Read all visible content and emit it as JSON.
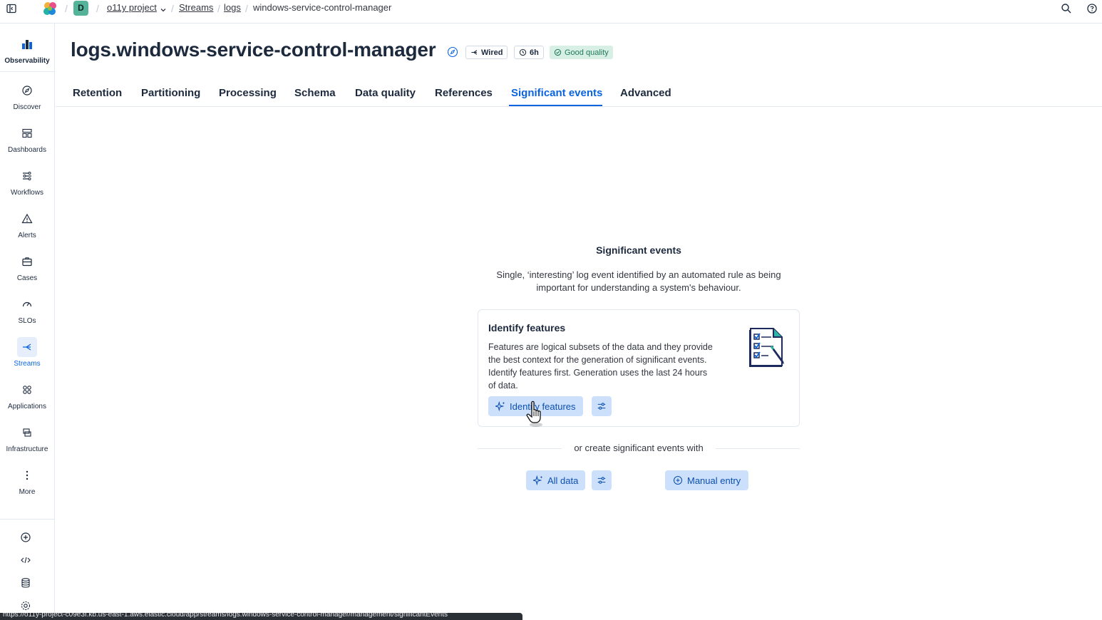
{
  "breadcrumbs": {
    "project_initial": "D",
    "project": "o11y project",
    "streams": "Streams",
    "logs": "logs",
    "current": "windows-service-control-manager"
  },
  "sidenav": {
    "app_label": "Observability",
    "items": [
      {
        "label": "Discover",
        "icon": "compass-icon"
      },
      {
        "label": "Dashboards",
        "icon": "dashboard-icon"
      },
      {
        "label": "Workflows",
        "icon": "workflow-icon"
      },
      {
        "label": "Alerts",
        "icon": "alert-icon"
      },
      {
        "label": "Cases",
        "icon": "briefcase-icon"
      },
      {
        "label": "SLOs",
        "icon": "gauge-icon"
      },
      {
        "label": "Streams",
        "icon": "streams-icon"
      },
      {
        "label": "Applications",
        "icon": "applications-icon"
      },
      {
        "label": "Infrastructure",
        "icon": "infrastructure-icon"
      },
      {
        "label": "More",
        "icon": "more-icon"
      }
    ],
    "active": "Streams"
  },
  "header": {
    "title": "logs.windows-service-control-manager",
    "badge_wired": "Wired",
    "badge_retention": "6h",
    "badge_quality": "Good quality"
  },
  "tabs": [
    "Retention",
    "Partitioning",
    "Processing",
    "Schema",
    "Data quality",
    "References",
    "Significant events",
    "Advanced"
  ],
  "active_tab": "Significant events",
  "empty_state": {
    "title": "Significant events",
    "description": "Single, ‘interesting’ log event identified by an automated rule as being important for understanding a system's behaviour."
  },
  "card": {
    "title": "Identify features",
    "description": "Features are logical subsets of the data and they provide the best context for the generation of significant events. Identify features first. Generation uses the last 24 hours of data.",
    "button_label": "Identify features"
  },
  "alt": {
    "divider_text": "or create significant events with",
    "all_data_label": "All data",
    "manual_entry_label": "Manual entry"
  },
  "status_url": "https://o11y-project-c09e3f.kb.us-east-1.aws.elastic.cloud/app/streams/logs.windows-service-control-manager/management/significantEvents",
  "colors": {
    "accent": "#0b64dd",
    "button_bg": "#cce0fb",
    "good_quality_bg": "#d7efe5"
  }
}
